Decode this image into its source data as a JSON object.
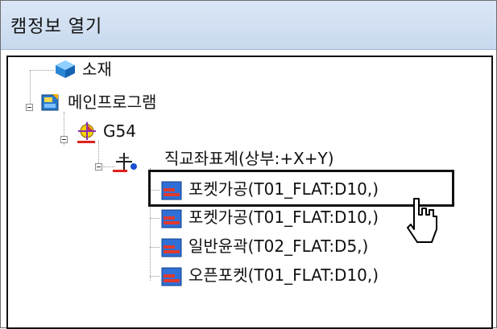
{
  "window": {
    "title": "캠정보 열기"
  },
  "tree": {
    "material": "소재",
    "main_program": "메인프로그램",
    "wcs": "G54",
    "coord": "직교좌표계(상부:+X+Y)",
    "operations": [
      "포켓가공(T01_FLAT:D10,)",
      "포켓가공(T01_FLAT:D10,)",
      "일반윤곽(T02_FLAT:D5,)",
      "오픈포켓(T01_FLAT:D10,)"
    ]
  },
  "icons": {
    "material": "blue-cube-icon",
    "main_program": "program-icon",
    "wcs": "origin-axis-icon",
    "coord": "coordinate-axis-icon",
    "operation": "toolpath-icon",
    "cursor": "mouse-pointer-icon"
  },
  "colors": {
    "operation_icon": "#2f6fd6",
    "operation_stripe": "#e03a2e",
    "cursor": "#ffffff"
  }
}
